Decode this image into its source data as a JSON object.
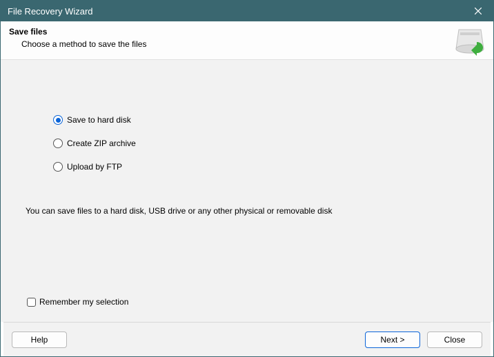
{
  "window": {
    "title": "File Recovery Wizard"
  },
  "header": {
    "title": "Save files",
    "subtitle": "Choose a method to save the files"
  },
  "options": {
    "save_disk": "Save to hard disk",
    "create_zip": "Create ZIP archive",
    "upload_ftp": "Upload by FTP",
    "selected": "save_disk"
  },
  "description": "You can save files to a hard disk, USB drive or any other physical or removable disk",
  "remember": {
    "label": "Remember my selection",
    "checked": false
  },
  "buttons": {
    "help": "Help",
    "next": "Next >",
    "close": "Close"
  }
}
